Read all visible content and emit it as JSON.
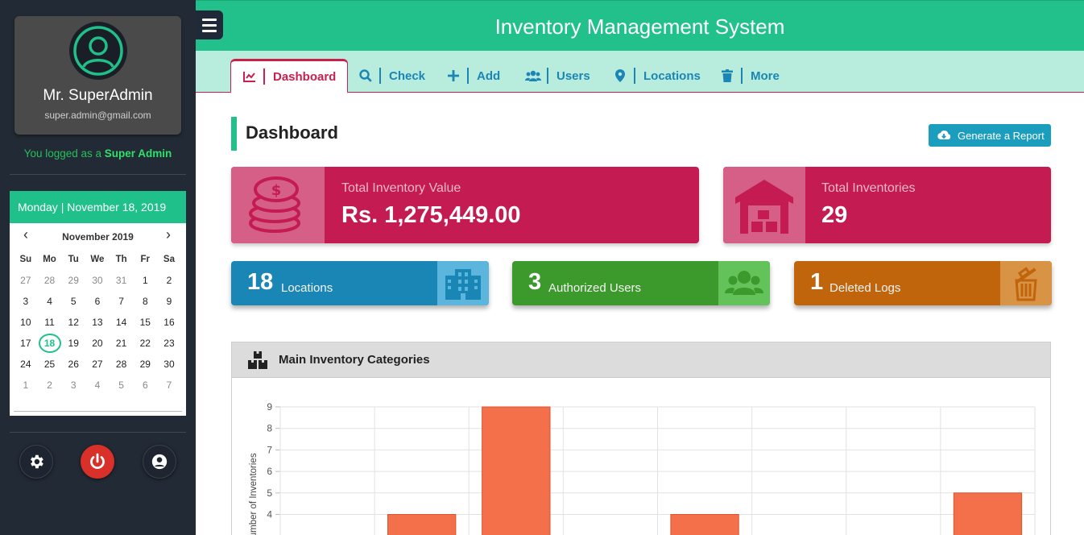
{
  "sidebar": {
    "user_name": "Mr. SuperAdmin",
    "user_email": "super.admin@gmail.com",
    "logged_prefix": "You logged as a",
    "logged_role": "Super Admin",
    "date_header": "Monday | November 18, 2019",
    "calendar": {
      "title": "November 2019",
      "prev": "‹",
      "next": "›",
      "weekdays": [
        "Su",
        "Mo",
        "Tu",
        "We",
        "Th",
        "Fr",
        "Sa"
      ],
      "today": "18",
      "weeks": [
        [
          {
            "d": "27",
            "m": true
          },
          {
            "d": "28",
            "m": true
          },
          {
            "d": "29",
            "m": true
          },
          {
            "d": "30",
            "m": true
          },
          {
            "d": "31",
            "m": true
          },
          {
            "d": "1"
          },
          {
            "d": "2"
          }
        ],
        [
          {
            "d": "3"
          },
          {
            "d": "4"
          },
          {
            "d": "5"
          },
          {
            "d": "6"
          },
          {
            "d": "7"
          },
          {
            "d": "8"
          },
          {
            "d": "9"
          }
        ],
        [
          {
            "d": "10"
          },
          {
            "d": "11"
          },
          {
            "d": "12"
          },
          {
            "d": "13"
          },
          {
            "d": "14"
          },
          {
            "d": "15"
          },
          {
            "d": "16"
          }
        ],
        [
          {
            "d": "17"
          },
          {
            "d": "18"
          },
          {
            "d": "19"
          },
          {
            "d": "20"
          },
          {
            "d": "21"
          },
          {
            "d": "22"
          },
          {
            "d": "23"
          }
        ],
        [
          {
            "d": "24"
          },
          {
            "d": "25"
          },
          {
            "d": "26"
          },
          {
            "d": "27"
          },
          {
            "d": "28"
          },
          {
            "d": "29"
          },
          {
            "d": "30"
          }
        ],
        [
          {
            "d": "1",
            "m": true
          },
          {
            "d": "2",
            "m": true
          },
          {
            "d": "3",
            "m": true
          },
          {
            "d": "4",
            "m": true
          },
          {
            "d": "5",
            "m": true
          },
          {
            "d": "6",
            "m": true
          },
          {
            "d": "7",
            "m": true
          }
        ]
      ]
    },
    "buttons": [
      "gear-icon",
      "power-icon",
      "user-circle-icon"
    ]
  },
  "header": {
    "title": "Inventory Management System"
  },
  "tabs": [
    {
      "label": "Dashboard",
      "icon": "chart-line-icon",
      "active": true
    },
    {
      "label": "Check",
      "icon": "search-icon"
    },
    {
      "label": "Add",
      "icon": "plus-icon"
    },
    {
      "label": "Users",
      "icon": "users-icon"
    },
    {
      "label": "Locations",
      "icon": "map-pin-icon"
    },
    {
      "label": "More",
      "icon": "trash-icon"
    }
  ],
  "main": {
    "heading": "Dashboard",
    "report_button": "Generate a Report",
    "total_value_label": "Total Inventory Value",
    "total_value": "Rs. 1,275,449.00",
    "total_inventories_label": "Total Inventories",
    "total_inventories": "29",
    "locations_count": "18",
    "locations_label": "Locations",
    "users_count": "3",
    "users_label": "Authorized Users",
    "deleted_count": "1",
    "deleted_label": "Deleted Logs",
    "panel_title": "Main Inventory Categories"
  },
  "colors": {
    "accent_green": "#22c18b",
    "crimson": "#c31b52",
    "blue": "#1b86b5",
    "card_green": "#3c9a2c",
    "card_orange": "#c0650c",
    "bar": "#f3704b"
  },
  "chart_data": {
    "type": "bar",
    "ylabel": "Number of Inventories",
    "yticks": [
      4,
      5,
      6,
      7,
      8,
      9
    ],
    "ylim_visible": [
      3.5,
      9
    ],
    "series": [
      {
        "values": [
          null,
          4,
          9,
          null,
          4,
          null,
          null,
          5
        ]
      }
    ]
  }
}
